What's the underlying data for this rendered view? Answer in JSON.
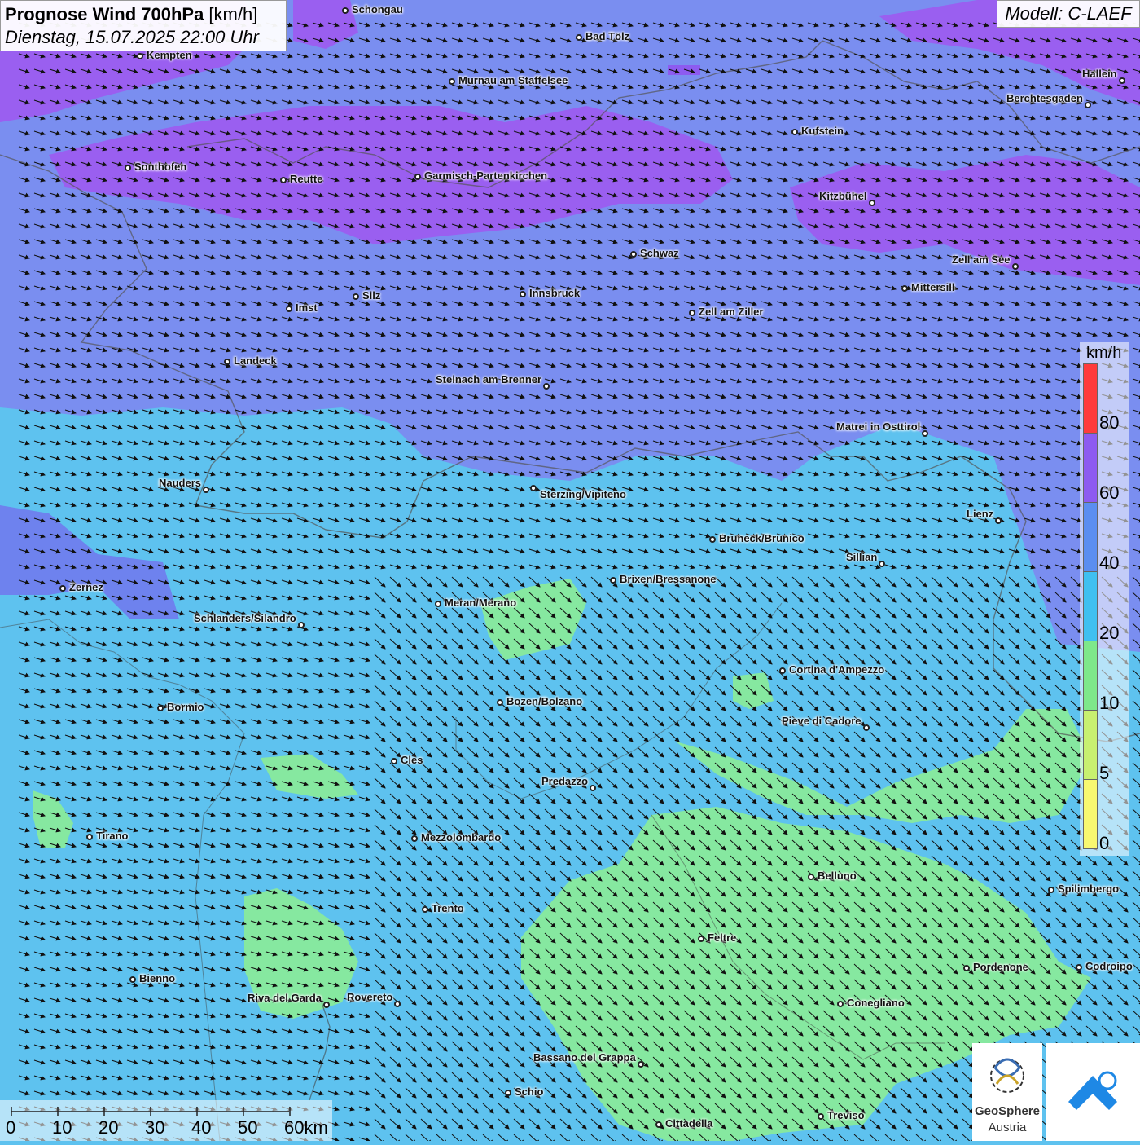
{
  "header": {
    "title_bold": "Prognose Wind 700hPa",
    "title_unit": " [km/h]",
    "datetime": "Dienstag, 15.07.2025 22:00 Uhr",
    "model": "Modell: C-LAEF"
  },
  "legend": {
    "unit": "km/h",
    "colors": [
      "#ff3b3b",
      "#8d5bf0",
      "#5b8ef0",
      "#3fc0f0",
      "#7ee88a",
      "#c8f070",
      "#f8f870"
    ],
    "ticks": [
      "80",
      "60",
      "40",
      "20",
      "10",
      "5",
      "0"
    ]
  },
  "scalebar": {
    "labels": [
      "0",
      "10",
      "20",
      "30",
      "40",
      "50",
      "60km"
    ]
  },
  "logos": {
    "geosphere_line1": "GeoSphere",
    "geosphere_line2": "Austria"
  },
  "map": {
    "wind_arrow_icon": "arrow-southeast-icon",
    "cities": [
      {
        "name": "Schongau"
      },
      {
        "name": "Bad Tölz"
      },
      {
        "name": "Kempten"
      },
      {
        "name": "Murnau am Staffelsee"
      },
      {
        "name": "Hallein"
      },
      {
        "name": "Berchtesgaden"
      },
      {
        "name": "Kufstein"
      },
      {
        "name": "Sonthofen"
      },
      {
        "name": "Reutte"
      },
      {
        "name": "Garmisch-Partenkirchen"
      },
      {
        "name": "Kitzbühel"
      },
      {
        "name": "Schwaz"
      },
      {
        "name": "Zell am See"
      },
      {
        "name": "Mittersill"
      },
      {
        "name": "Innsbruck"
      },
      {
        "name": "Silz"
      },
      {
        "name": "Imst"
      },
      {
        "name": "Zell am Ziller"
      },
      {
        "name": "Landeck"
      },
      {
        "name": "Steinach am Brenner"
      },
      {
        "name": "Matrei in Osttirol"
      },
      {
        "name": "Nauders"
      },
      {
        "name": "Sterzing/Vipiteno"
      },
      {
        "name": "Lienz"
      },
      {
        "name": "Bruneck/Brunico"
      },
      {
        "name": "Sillian"
      },
      {
        "name": "Zernez"
      },
      {
        "name": "Brixen/Bressanone"
      },
      {
        "name": "Meran/Merano"
      },
      {
        "name": "Schlanders/Silandro"
      },
      {
        "name": "Cortina d'Ampezzo"
      },
      {
        "name": "Bozen/Bolzano"
      },
      {
        "name": "Bormio"
      },
      {
        "name": "Pieve di Cadore"
      },
      {
        "name": "Cles"
      },
      {
        "name": "Predazzo"
      },
      {
        "name": "Tirano"
      },
      {
        "name": "Mezzolombardo"
      },
      {
        "name": "Belluno"
      },
      {
        "name": "Spilimbergo"
      },
      {
        "name": "Trento"
      },
      {
        "name": "Feltre"
      },
      {
        "name": "Bienno"
      },
      {
        "name": "Pordenone"
      },
      {
        "name": "Codroipo"
      },
      {
        "name": "Riva del Garda"
      },
      {
        "name": "Rovereto"
      },
      {
        "name": "Conegliano"
      },
      {
        "name": "Bassano del Grappa"
      },
      {
        "name": "Schio"
      },
      {
        "name": "Treviso"
      },
      {
        "name": "Cittadella"
      }
    ]
  }
}
